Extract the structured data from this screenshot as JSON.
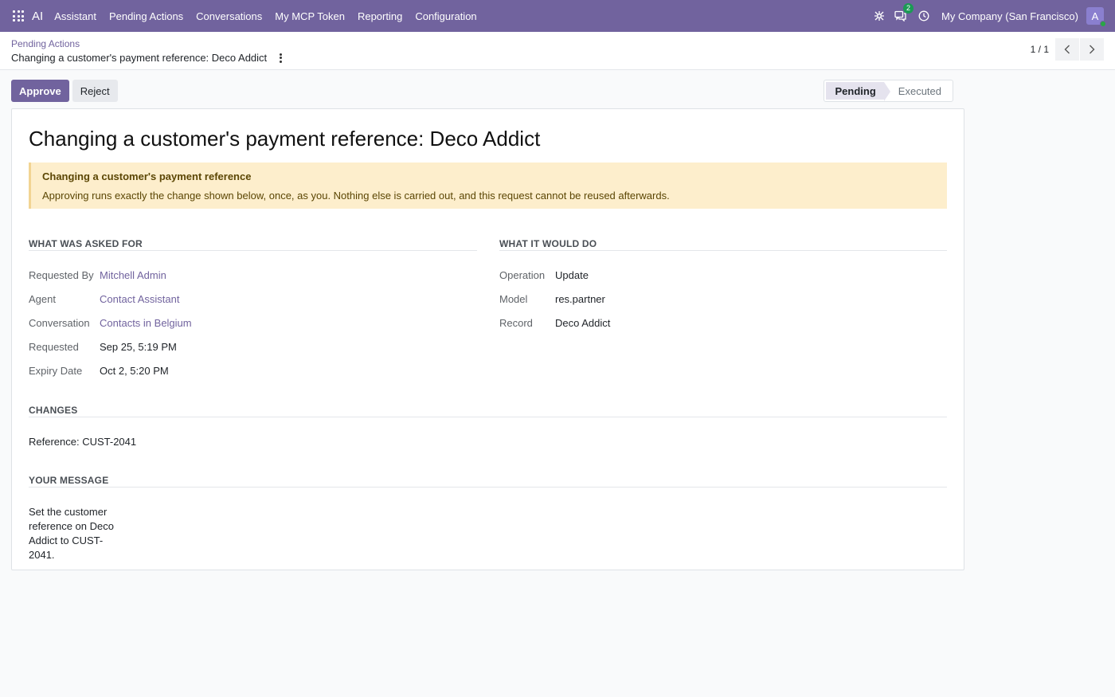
{
  "navbar": {
    "brand": "AI",
    "menu": [
      "Assistant",
      "Pending Actions",
      "Conversations",
      "My MCP Token",
      "Reporting",
      "Configuration"
    ],
    "messages_badge": "2",
    "company": "My Company (San Francisco)",
    "avatar_initial": "A"
  },
  "breadcrumb": {
    "parent": "Pending Actions",
    "current": "Changing a customer's payment reference: Deco Addict"
  },
  "pager": {
    "value": "1 / 1"
  },
  "actions": {
    "approve": "Approve",
    "reject": "Reject"
  },
  "status": {
    "stages": [
      "Pending",
      "Executed"
    ],
    "active": "Pending"
  },
  "record": {
    "title": "Changing a customer's payment reference: Deco Addict",
    "alert_title": "Changing a customer's payment reference",
    "alert_body": "Approving runs exactly the change shown below, once, as you. Nothing else is carried out, and this request cannot be reused afterwards.",
    "asked": {
      "heading": "What was asked for",
      "fields": [
        {
          "label": "Requested By",
          "value": "Mitchell Admin"
        },
        {
          "label": "Agent",
          "value": "Contact Assistant"
        },
        {
          "label": "Conversation",
          "value": "Contacts in Belgium"
        },
        {
          "label": "Requested",
          "value": "Sep 25, 5:19 PM"
        },
        {
          "label": "Expiry Date",
          "value": "Oct 2, 5:20 PM"
        }
      ]
    },
    "would_do": {
      "heading": "What it would do",
      "fields": [
        {
          "label": "Operation",
          "value": "Update"
        },
        {
          "label": "Model",
          "value": "res.partner"
        },
        {
          "label": "Record",
          "value": "Deco Addict"
        }
      ]
    },
    "changes": {
      "heading": "Changes",
      "text": "Reference: CUST-2041"
    },
    "message": {
      "heading": "Your message",
      "text": "Set the customer reference on Deco Addict to CUST-2041."
    }
  },
  "colors": {
    "brand": "#71639e",
    "alert_bg": "#fdeecc",
    "badge": "#1c9a55"
  },
  "icons": [
    "apps-grid-icon",
    "bug-icon",
    "chat-icon",
    "clock-icon",
    "chevron-left-icon",
    "chevron-right-icon",
    "kebab-icon"
  ]
}
